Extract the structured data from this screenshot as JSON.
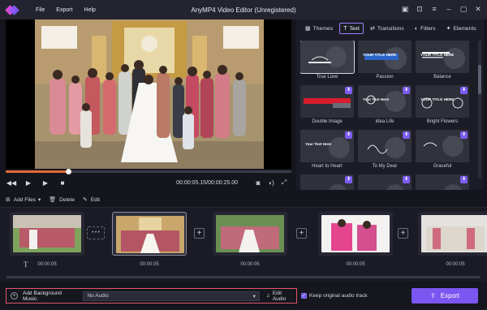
{
  "app": {
    "title": "AnyMP4 Video Editor (Unregistered)"
  },
  "menu": [
    "File",
    "Export",
    "Help"
  ],
  "player": {
    "timecode": "00:00:05.15/00:00:25.00",
    "progress": 0.22
  },
  "tabs": [
    {
      "label": "Themes",
      "icon": "themes-icon",
      "glyph": "▦"
    },
    {
      "label": "Text",
      "icon": "text-icon",
      "glyph": "T",
      "active": true
    },
    {
      "label": "Transitions",
      "icon": "transitions-icon",
      "glyph": "⇄"
    },
    {
      "label": "Filters",
      "icon": "filters-icon",
      "glyph": "◐"
    },
    {
      "label": "Elements",
      "icon": "elements-icon",
      "glyph": "✦"
    }
  ],
  "text_templates": [
    {
      "label": "True Love",
      "caption": "",
      "style": "truelove",
      "download": false,
      "selected": true
    },
    {
      "label": "Passion",
      "caption": "YOUR TITLE HERE",
      "style": "passion",
      "download": false
    },
    {
      "label": "Balance",
      "caption": "YOUR TITLE HERE",
      "style": "balance",
      "download": false
    },
    {
      "label": "Double Image",
      "caption": "",
      "style": "double",
      "download": true
    },
    {
      "label": "Idea Life",
      "caption": "Your Text Here",
      "style": "idea",
      "download": true
    },
    {
      "label": "Bright Flowers",
      "caption": "YOUR TITLE HERE",
      "style": "flowers",
      "download": true
    },
    {
      "label": "Heart to Heart",
      "caption": "Your Text Here",
      "style": "heart",
      "download": true
    },
    {
      "label": "To My Dear",
      "caption": "",
      "style": "dear",
      "download": true
    },
    {
      "label": "Graceful",
      "caption": "",
      "style": "graceful",
      "download": true
    },
    {
      "label": "",
      "caption": "",
      "style": "more",
      "download": true
    },
    {
      "label": "",
      "caption": "",
      "style": "more",
      "download": true
    },
    {
      "label": "",
      "caption": "",
      "style": "more",
      "download": true
    }
  ],
  "toolbar": {
    "add_files": "Add Files",
    "delete": "Delete",
    "edit": "Edit"
  },
  "clips": [
    {
      "duration": "00:00:05",
      "scene": "group-outdoor"
    },
    {
      "duration": "00:00:05",
      "scene": "church",
      "selected": true
    },
    {
      "duration": "00:00:05",
      "scene": "group-garden"
    },
    {
      "duration": "00:00:05",
      "scene": "kids-pink"
    },
    {
      "duration": "00:00:05",
      "scene": "family-white"
    }
  ],
  "bottom": {
    "add_bgm_label": "Add Background Music:",
    "audio_value": "No Audio",
    "edit_audio": "Edit Audio",
    "keep_audio": "Keep original audio track",
    "export": "Export"
  },
  "colors": {
    "accent": "#7b56f0",
    "highlight": "#e0566b",
    "seek": "#e46a3a"
  }
}
